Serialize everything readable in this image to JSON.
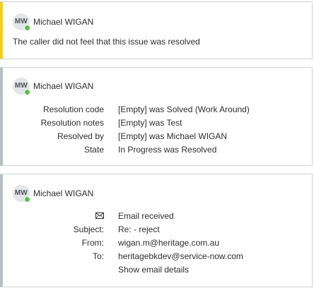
{
  "entries": [
    {
      "avatar_initials": "MW",
      "author": "Michael WIGAN",
      "message": "The caller did not feel that this issue was resolved"
    },
    {
      "avatar_initials": "MW",
      "author": "Michael WIGAN",
      "fields": [
        {
          "label": "Resolution code",
          "value": "[Empty] was Solved (Work Around)"
        },
        {
          "label": "Resolution notes",
          "value": "[Empty] was Test"
        },
        {
          "label": "Resolved by",
          "value": "[Empty] was Michael WIGAN"
        },
        {
          "label": "State",
          "value": "In Progress was Resolved"
        }
      ]
    },
    {
      "avatar_initials": "MW",
      "author": "Michael WIGAN",
      "email": {
        "icon": "envelope-icon",
        "status": "Email received",
        "subject_label": "Subject:",
        "subject": "Re: - reject",
        "from_label": "From:",
        "from": "wigan.m@heritage.com.au",
        "to_label": "To:",
        "to": "heritagebkdev@service-now.com",
        "details_link": "Show email details"
      }
    }
  ],
  "colors": {
    "highlight_bar": "#f1cf1f",
    "default_bar": "#b9bec4",
    "presence_online": "#57c04a",
    "link": "#1f78c1"
  }
}
